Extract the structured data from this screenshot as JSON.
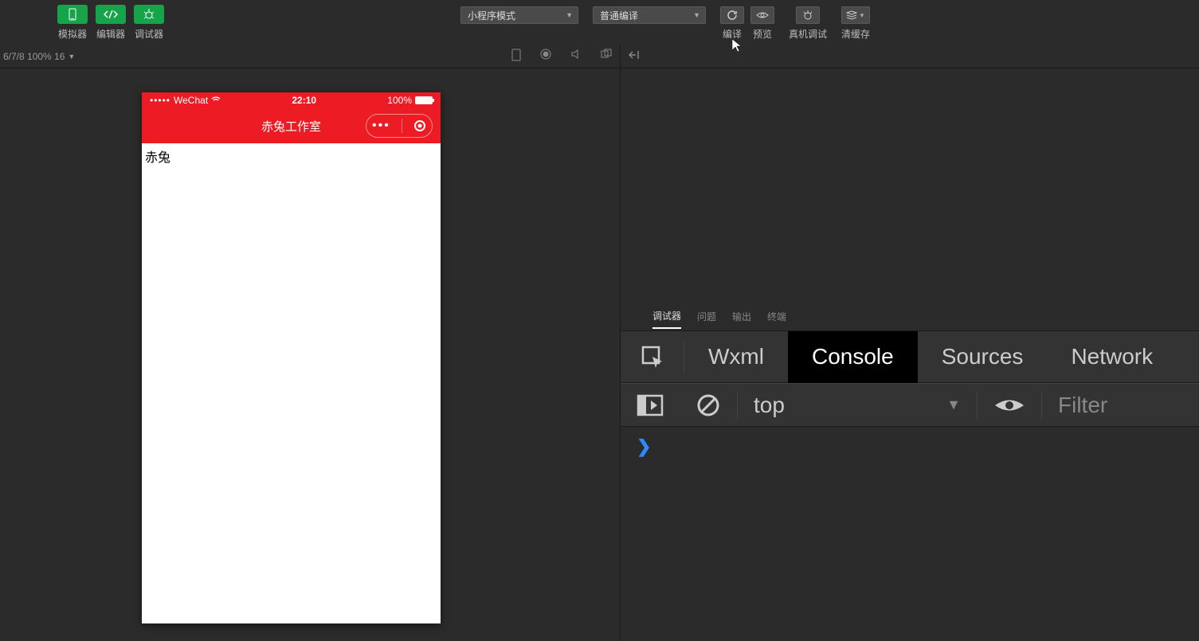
{
  "toolbar": {
    "simulator_label": "模拟器",
    "editor_label": "编辑器",
    "debugger_label": "调试器",
    "mode_select": "小程序模式",
    "compile_select": "普通编译",
    "compile_label": "编译",
    "preview_label": "预览",
    "remote_debug_label": "真机调试",
    "clear_cache_label": "清缓存"
  },
  "status": {
    "text": "6/7/8 100% 16"
  },
  "phone": {
    "carrier": "WeChat",
    "time": "22:10",
    "battery_pct": "100%",
    "nav_title": "赤兔工作室",
    "body_text": "赤兔"
  },
  "devtools": {
    "tabs": {
      "debugger": "调试器",
      "problems": "问题",
      "output": "输出",
      "terminal": "终端"
    },
    "main_tabs": {
      "wxml": "Wxml",
      "console": "Console",
      "sources": "Sources",
      "network": "Network"
    },
    "console": {
      "context": "top",
      "filter_placeholder": "Filter"
    }
  }
}
